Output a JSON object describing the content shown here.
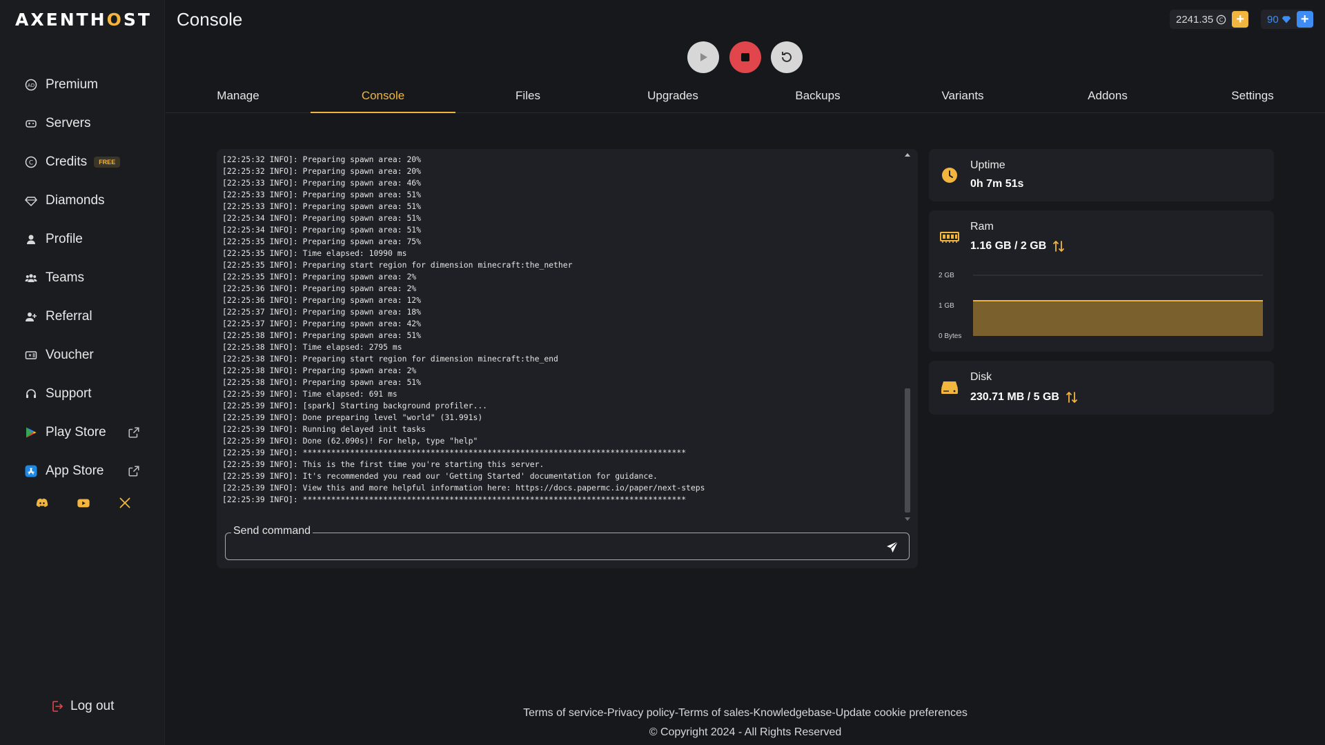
{
  "brand": {
    "logo_pre": "AXENTH",
    "logo_o": "O",
    "logo_post": "ST"
  },
  "header": {
    "title": "Console",
    "credits_balance": "2241.35",
    "diamonds_balance": "90"
  },
  "sidebar": {
    "items": [
      {
        "label": "Premium"
      },
      {
        "label": "Servers"
      },
      {
        "label": "Credits",
        "badge": "FREE"
      },
      {
        "label": "Diamonds"
      },
      {
        "label": "Profile"
      },
      {
        "label": "Teams"
      },
      {
        "label": "Referral"
      },
      {
        "label": "Voucher"
      },
      {
        "label": "Support"
      },
      {
        "label": "Play Store"
      },
      {
        "label": "App Store"
      }
    ],
    "logout": "Log out"
  },
  "tabs": [
    "Manage",
    "Console",
    "Files",
    "Upgrades",
    "Backups",
    "Variants",
    "Addons",
    "Settings"
  ],
  "console": {
    "lines": [
      "[22:25:32 INFO]: Preparing spawn area: 20%",
      "[22:25:32 INFO]: Preparing spawn area: 20%",
      "[22:25:33 INFO]: Preparing spawn area: 46%",
      "[22:25:33 INFO]: Preparing spawn area: 51%",
      "[22:25:33 INFO]: Preparing spawn area: 51%",
      "[22:25:34 INFO]: Preparing spawn area: 51%",
      "[22:25:34 INFO]: Preparing spawn area: 51%",
      "[22:25:35 INFO]: Preparing spawn area: 75%",
      "[22:25:35 INFO]: Time elapsed: 10990 ms",
      "[22:25:35 INFO]: Preparing start region for dimension minecraft:the_nether",
      "[22:25:35 INFO]: Preparing spawn area: 2%",
      "[22:25:36 INFO]: Preparing spawn area: 2%",
      "[22:25:36 INFO]: Preparing spawn area: 12%",
      "[22:25:37 INFO]: Preparing spawn area: 18%",
      "[22:25:37 INFO]: Preparing spawn area: 42%",
      "[22:25:38 INFO]: Preparing spawn area: 51%",
      "[22:25:38 INFO]: Time elapsed: 2795 ms",
      "[22:25:38 INFO]: Preparing start region for dimension minecraft:the_end",
      "[22:25:38 INFO]: Preparing spawn area: 2%",
      "[22:25:38 INFO]: Preparing spawn area: 51%",
      "[22:25:39 INFO]: Time elapsed: 691 ms",
      "[22:25:39 INFO]: [spark] Starting background profiler...",
      "[22:25:39 INFO]: Done preparing level \"world\" (31.991s)",
      "[22:25:39 INFO]: Running delayed init tasks",
      "[22:25:39 INFO]: Done (62.090s)! For help, type \"help\"",
      "[22:25:39 INFO]: *********************************************************************************",
      "[22:25:39 INFO]: This is the first time you're starting this server.",
      "[22:25:39 INFO]: It's recommended you read our 'Getting Started' documentation for guidance.",
      "[22:25:39 INFO]: View this and more helpful information here: https://docs.papermc.io/paper/next-steps",
      "[22:25:39 INFO]: *********************************************************************************"
    ],
    "command_label": "Send command",
    "command_value": ""
  },
  "stats": {
    "uptime": {
      "label": "Uptime",
      "value": "0h 7m 51s"
    },
    "ram": {
      "label": "Ram",
      "value": "1.16 GB / 2 GB"
    },
    "disk": {
      "label": "Disk",
      "value": "230.71 MB / 5 GB"
    }
  },
  "chart_data": {
    "type": "area",
    "y_ticks": [
      "2 GB",
      "1 GB",
      "0 Bytes"
    ],
    "ylim": [
      0,
      2
    ],
    "series": [
      {
        "values": [
          1.16,
          1.16,
          1.16,
          1.16,
          1.16,
          1.16,
          1.16,
          1.16
        ]
      }
    ],
    "color": "#f2b53d"
  },
  "footer": {
    "links": [
      "Terms of service",
      "Privacy policy",
      "Terms of sales",
      "Knowledgebase",
      "Update cookie preferences"
    ],
    "copyright": "© Copyright 2024 - All Rights Reserved"
  },
  "colors": {
    "accent": "#f2b53d",
    "stop": "#e0464b",
    "diamond": "#3d8df5"
  }
}
